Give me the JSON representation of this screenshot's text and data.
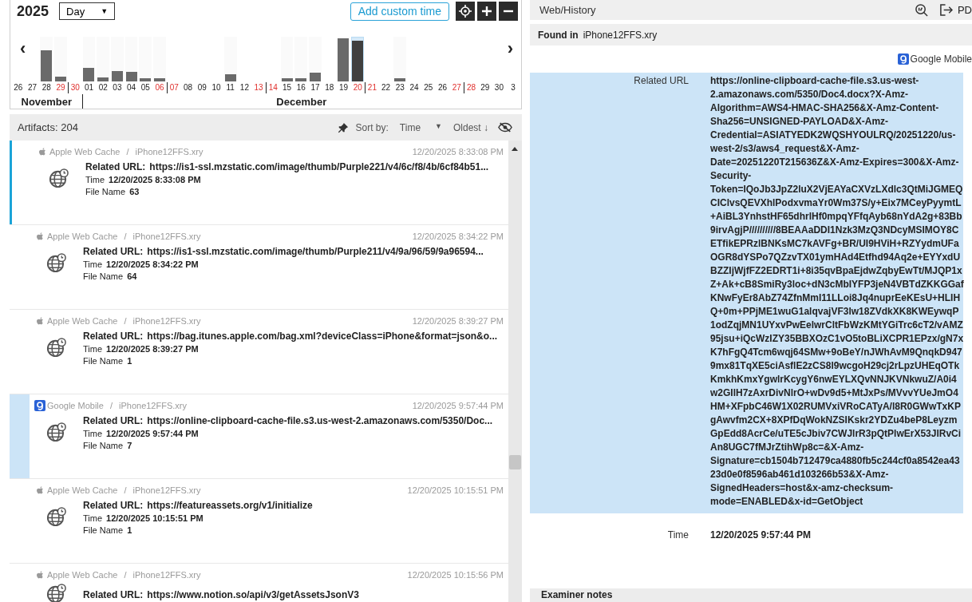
{
  "timeline": {
    "year": "2025",
    "zoom": {
      "value": "Day",
      "caret": "▼"
    },
    "add_button": "Add custom time",
    "prev": "‹",
    "next": "›",
    "months": [
      {
        "label": "November",
        "days": [
          {
            "label": "26",
            "weekend": false,
            "week_start": false,
            "selected": false
          },
          {
            "label": "27",
            "weekend": false,
            "week_start": false,
            "selected": false
          },
          {
            "label": "28",
            "weekend": false,
            "week_start": false,
            "selected": false,
            "level": 0.7
          },
          {
            "label": "29",
            "weekend": true,
            "week_start": false,
            "selected": false,
            "level": 0.11
          },
          {
            "label": "30",
            "weekend": true,
            "week_start": true,
            "selected": false
          }
        ]
      },
      {
        "label": "December",
        "days": [
          {
            "label": "01",
            "weekend": false,
            "week_start": false,
            "selected": false,
            "level": 0.3
          },
          {
            "label": "02",
            "weekend": false,
            "week_start": false,
            "selected": false,
            "level": 0.09
          },
          {
            "label": "03",
            "weekend": false,
            "week_start": false,
            "selected": false,
            "level": 0.23
          },
          {
            "label": "04",
            "weekend": false,
            "week_start": false,
            "selected": false,
            "level": 0.21
          },
          {
            "label": "05",
            "weekend": false,
            "week_start": false,
            "selected": false,
            "level": 0.07
          },
          {
            "label": "06",
            "weekend": true,
            "week_start": false,
            "selected": false,
            "level": 0.07
          },
          {
            "label": "07",
            "weekend": true,
            "week_start": true,
            "selected": false
          },
          {
            "label": "08",
            "weekend": false,
            "week_start": false,
            "selected": false
          },
          {
            "label": "09",
            "weekend": false,
            "week_start": false,
            "selected": false
          },
          {
            "label": "10",
            "weekend": false,
            "week_start": false,
            "selected": false
          },
          {
            "label": "11",
            "weekend": false,
            "week_start": false,
            "selected": false,
            "level": 0.16
          },
          {
            "label": "12",
            "weekend": false,
            "week_start": false,
            "selected": false
          },
          {
            "label": "13",
            "weekend": true,
            "week_start": false,
            "selected": false
          },
          {
            "label": "14",
            "weekend": true,
            "week_start": true,
            "selected": false
          },
          {
            "label": "15",
            "weekend": false,
            "week_start": false,
            "selected": false,
            "level": 0.07
          },
          {
            "label": "16",
            "weekend": false,
            "week_start": false,
            "selected": false,
            "level": 0.07
          },
          {
            "label": "17",
            "weekend": false,
            "week_start": false,
            "selected": false,
            "level": 0.2
          },
          {
            "label": "18",
            "weekend": false,
            "week_start": false,
            "selected": false
          },
          {
            "label": "19",
            "weekend": false,
            "week_start": false,
            "selected": false,
            "level": 0.96
          },
          {
            "label": "20",
            "weekend": true,
            "week_start": false,
            "selected": true,
            "level": 0.91
          },
          {
            "label": "21",
            "weekend": true,
            "week_start": true,
            "selected": false
          },
          {
            "label": "22",
            "weekend": false,
            "week_start": false,
            "selected": false
          },
          {
            "label": "23",
            "weekend": false,
            "week_start": false,
            "selected": false,
            "level": 0.07
          },
          {
            "label": "24",
            "weekend": false,
            "week_start": false,
            "selected": false
          },
          {
            "label": "25",
            "weekend": false,
            "week_start": false,
            "selected": false
          },
          {
            "label": "26",
            "weekend": false,
            "week_start": false,
            "selected": false
          },
          {
            "label": "27",
            "weekend": true,
            "week_start": false,
            "selected": false
          },
          {
            "label": "28",
            "weekend": true,
            "week_start": true,
            "selected": false
          },
          {
            "label": "29",
            "weekend": false,
            "week_start": false,
            "selected": false
          },
          {
            "label": "30",
            "weekend": false,
            "week_start": false,
            "selected": false
          },
          {
            "label": "3",
            "weekend": false,
            "week_start": false,
            "selected": false
          }
        ]
      }
    ]
  },
  "toolbar": {
    "count": "Artifacts: 204",
    "sort_label": "Sort by:",
    "sort_value": "Time",
    "sort_caret": "▼",
    "order": "Oldest ↓"
  },
  "artifacts": [
    {
      "kind": "apple",
      "source": "Apple Web Cache",
      "separator": "/",
      "device": "iPhone12FFS.xry",
      "timestamp": "12/20/2025 8:33:08 PM",
      "selected": false,
      "focused": true,
      "fields": [
        {
          "label": "Related URL:",
          "value": "https://is1-ssl.mzstatic.com/image/thumb/Purple221/v4/6c/f8/4b/6cf84b51..."
        },
        {
          "label": "Time",
          "value": "12/20/2025 8:33:08 PM"
        },
        {
          "label": "File Name",
          "value": "63"
        }
      ]
    },
    {
      "kind": "apple",
      "source": "Apple Web Cache",
      "separator": "/",
      "device": "iPhone12FFS.xry",
      "timestamp": "12/20/2025 8:34:22 PM",
      "selected": false,
      "focused": false,
      "fields": [
        {
          "label": "Related URL:",
          "value": "https://is1-ssl.mzstatic.com/image/thumb/Purple211/v4/9a/96/59/9a96594..."
        },
        {
          "label": "Time",
          "value": "12/20/2025 8:34:22 PM"
        },
        {
          "label": "File Name",
          "value": "64"
        }
      ]
    },
    {
      "kind": "apple",
      "source": "Apple Web Cache",
      "separator": "/",
      "device": "iPhone12FFS.xry",
      "timestamp": "12/20/2025 8:39:27 PM",
      "selected": false,
      "focused": false,
      "fields": [
        {
          "label": "Related URL:",
          "value": "https://bag.itunes.apple.com/bag.xml?deviceClass=iPhone&format=json&o..."
        },
        {
          "label": "Time",
          "value": "12/20/2025 8:39:27 PM"
        },
        {
          "label": "File Name",
          "value": "1"
        }
      ]
    },
    {
      "kind": "google",
      "source": "Google Mobile",
      "separator": "/",
      "device": "iPhone12FFS.xry",
      "timestamp": "12/20/2025 9:57:44 PM",
      "selected": true,
      "focused": false,
      "fields": [
        {
          "label": "Related URL:",
          "value": "https://online-clipboard-cache-file.s3.us-west-2.amazonaws.com/5350/Doc..."
        },
        {
          "label": "Time",
          "value": "12/20/2025 9:57:44 PM"
        },
        {
          "label": "File Name",
          "value": "7"
        }
      ]
    },
    {
      "kind": "apple",
      "source": "Apple Web Cache",
      "separator": "/",
      "device": "iPhone12FFS.xry",
      "timestamp": "12/20/2025 10:15:51 PM",
      "selected": false,
      "focused": false,
      "fields": [
        {
          "label": "Related URL:",
          "value": "https://featureassets.org/v1/initialize"
        },
        {
          "label": "Time",
          "value": "12/20/2025 10:15:51 PM"
        },
        {
          "label": "File Name",
          "value": "1"
        }
      ]
    },
    {
      "kind": "apple",
      "source": "Apple Web Cache",
      "separator": "/",
      "device": "iPhone12FFS.xry",
      "timestamp": "12/20/2025 10:15:56 PM",
      "selected": false,
      "focused": false,
      "fields": [
        {
          "label": "Related URL:",
          "value": "https://www.notion.so/api/v3/getAssetsJsonV3"
        }
      ]
    }
  ],
  "detail": {
    "title": "Web/History",
    "export_label": "PD",
    "found_label": "Found in",
    "found_value": "iPhone12FFS.xry",
    "source": {
      "kind": "google",
      "name": "Google Mobile"
    },
    "fields": [
      {
        "label": "Related URL",
        "selected": true,
        "value": "https://online-clipboard-cache-file.s3.us-west-2.amazonaws.com/5350/Doc4.docx?X-Amz-Algorithm=AWS4-HMAC-SHA256&X-Amz-Content-Sha256=UNSIGNED-PAYLOAD&X-Amz-Credential=ASIATYEDK2WQSHYOULRQ/20251220/us-west-2/s3/aws4_request&X-Amz-Date=20251220T215636Z&X-Amz-Expires=300&X-Amz-Security-Token=IQoJb3JpZ2luX2VjEAYaCXVzLXdlc3QtMiJGMEQCIClvsQEVXhlPodxvmaYr0Wm37S/y+Eix7MCeyPyymtL+AiBL3YnhstHF65dhrlHf0mpqYFfqAyb68nYdA2g+83Bb9irvAgjP//////////8BEAAaDDI1Nzk3MzQ3NDcyMSIMOY8CETfikEPRzlBNKsMC7kAVFg+BR/UI9HViH+RZYydmUFaOGR8dYSPo7QZzvTX01ymHAd4Etfhd94Aq2e+EYYxdUBZZIjWjfFZ2EDRT1i+8i35qvBpaEjdwZqbyEwTt/MJQP1xZ+Ak+cB8SmiRy3loc+dN3cMbIYFP3jeN4VBTdZKKGGafKNwFyEr8AbZ74ZfnMmI11LLoi8Jq4nuprEeKEsU+HLIHQ+0m+PPjME1wuG1alqvajVF3lw18ZVdkXK8KWEywqP1odZqjMN1UYxvPwEelwrCltFbWzKMtYGiTrc6cT2/vAMZ95jsu+iQcWzIZY35BBXOzC1vO5toBLiXCPR1EPzx/gN7xK7hFgQ4Tcm6wqj64SMw+9oBeY/nJWhAvM9QnqkD9479mx81TqXE5ciAsflE2zCS8l9wcgoH29cj2rLpzUHEqOTkKmkhKmxYgwlrKcygY6nwEYLXQvNNJKVNkwuZ/A0i4w2GIlH7zAxrDivNlrO+wDv9d5+MtJxPs/MVvvYUeJmO4HM+XFpbC46W1X02RUMVxiVRoCATyA/l8R0GWwTxKPgAwvfm2CX+8XPfDqWokNZSIKskr2YDZu4beP8LeyzmGpEdd8AcrCe/uTE5cJbiv7CWJlrR3pQtPlwErX53JlRvCiAn8UGC7fMJrZtihWp8c=&X-Amz-Signature=cb1504b712479ca4880fb5c244cf0a8542ea4323d0e0f8596ab461d103266b53&X-Amz-SignedHeaders=host&x-amz-checksum-mode=ENABLED&x-id=GetObject"
      },
      {
        "label": "Time",
        "selected": false,
        "value": "12/20/2025 9:57:44 PM"
      }
    ],
    "notes_label": "Examiner notes"
  }
}
